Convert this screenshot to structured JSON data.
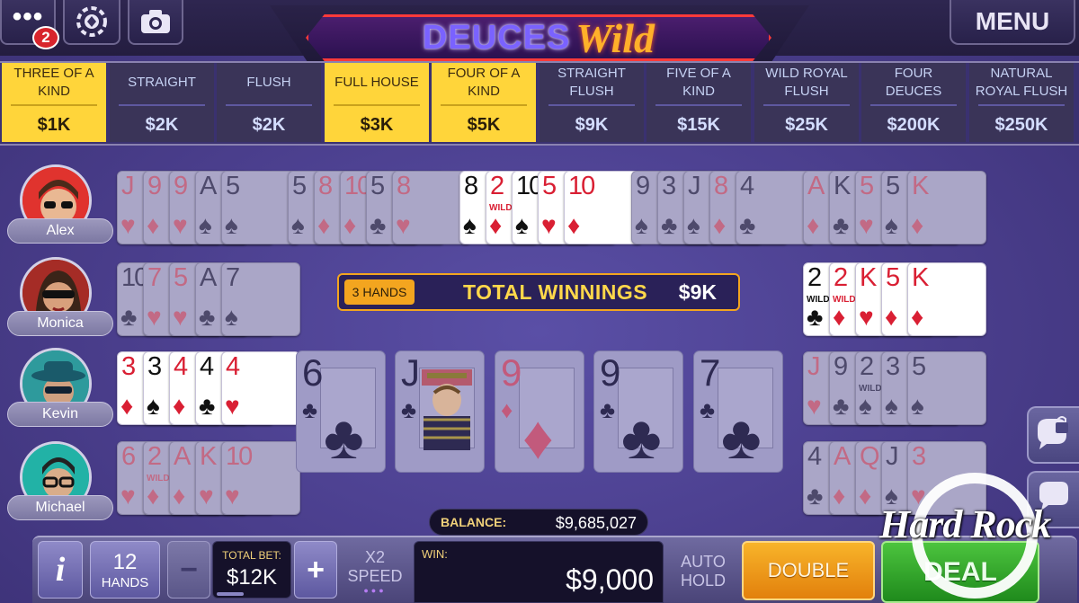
{
  "topbar": {
    "notification_count": "2",
    "menu_label": "MENU",
    "logo_word1": "DEUCES",
    "logo_word2": "Wild"
  },
  "paytable": [
    {
      "name": "THREE OF A KIND",
      "value": "$1K",
      "highlighted": true
    },
    {
      "name": "STRAIGHT",
      "value": "$2K",
      "highlighted": false
    },
    {
      "name": "FLUSH",
      "value": "$2K",
      "highlighted": false
    },
    {
      "name": "FULL HOUSE",
      "value": "$3K",
      "highlighted": true
    },
    {
      "name": "FOUR OF A KIND",
      "value": "$5K",
      "highlighted": true
    },
    {
      "name": "STRAIGHT FLUSH",
      "value": "$9K",
      "highlighted": false
    },
    {
      "name": "FIVE OF A KIND",
      "value": "$15K",
      "highlighted": false
    },
    {
      "name": "WILD ROYAL FLUSH",
      "value": "$25K",
      "highlighted": false
    },
    {
      "name": "FOUR DEUCES",
      "value": "$200K",
      "highlighted": false
    },
    {
      "name": "NATURAL ROYAL FLUSH",
      "value": "$250K",
      "highlighted": false
    }
  ],
  "players": [
    "Alex",
    "Monica",
    "Kevin",
    "Michael"
  ],
  "hands": [
    {
      "dim": true,
      "cards": [
        [
          "J",
          "h"
        ],
        [
          "9",
          "d"
        ],
        [
          "9",
          "h"
        ],
        [
          "A",
          "s"
        ],
        [
          "5",
          "s"
        ]
      ]
    },
    {
      "dim": true,
      "cards": [
        [
          "5",
          "s"
        ],
        [
          "8",
          "d"
        ],
        [
          "10",
          "d"
        ],
        [
          "5",
          "c"
        ],
        [
          "8",
          "h"
        ]
      ]
    },
    {
      "dim": false,
      "cards": [
        [
          "8",
          "s"
        ],
        [
          "2",
          "d",
          "WILD"
        ],
        [
          "10",
          "s"
        ],
        [
          "5",
          "h"
        ],
        [
          "10",
          "d"
        ]
      ]
    },
    {
      "dim": true,
      "cards": [
        [
          "9",
          "s"
        ],
        [
          "3",
          "c"
        ],
        [
          "J",
          "s"
        ],
        [
          "8",
          "d"
        ],
        [
          "4",
          "c"
        ]
      ]
    },
    {
      "dim": true,
      "cards": [
        [
          "A",
          "d"
        ],
        [
          "K",
          "c"
        ],
        [
          "5",
          "h"
        ],
        [
          "5",
          "s"
        ],
        [
          "K",
          "d"
        ]
      ]
    },
    {
      "dim": true,
      "cards": [
        [
          "10",
          "c"
        ],
        [
          "7",
          "h"
        ],
        [
          "5",
          "h"
        ],
        [
          "A",
          "c"
        ],
        [
          "7",
          "s"
        ]
      ]
    },
    {
      "dim": false,
      "cards": [
        [
          "2",
          "c",
          "WILD"
        ],
        [
          "2",
          "d",
          "WILD"
        ],
        [
          "K",
          "h"
        ],
        [
          "5",
          "d"
        ],
        [
          "K",
          "d"
        ]
      ]
    },
    {
      "dim": false,
      "cards": [
        [
          "3",
          "d"
        ],
        [
          "3",
          "s"
        ],
        [
          "4",
          "d"
        ],
        [
          "4",
          "c"
        ],
        [
          "4",
          "h"
        ]
      ]
    },
    {
      "dim": true,
      "cards": [
        [
          "J",
          "h"
        ],
        [
          "9",
          "c"
        ],
        [
          "2",
          "s",
          "WILD"
        ],
        [
          "3",
          "s"
        ],
        [
          "5",
          "s"
        ]
      ]
    },
    {
      "dim": true,
      "cards": [
        [
          "6",
          "h"
        ],
        [
          "2",
          "d",
          "WILD"
        ],
        [
          "A",
          "d"
        ],
        [
          "K",
          "h"
        ],
        [
          "10",
          "h"
        ]
      ]
    },
    {
      "dim": true,
      "cards": [
        [
          "4",
          "c"
        ],
        [
          "A",
          "d"
        ],
        [
          "Q",
          "d"
        ],
        [
          "J",
          "s"
        ],
        [
          "3",
          "h"
        ]
      ]
    }
  ],
  "banner": {
    "hands": "3 HANDS",
    "title": "TOTAL WINNINGS",
    "amount": "$9K"
  },
  "main_hand": [
    [
      "6",
      "c"
    ],
    [
      "J",
      "c"
    ],
    [
      "9",
      "d"
    ],
    [
      "9",
      "c"
    ],
    [
      "7",
      "c"
    ]
  ],
  "controls": {
    "info_label": "i",
    "hands_count": "12",
    "hands_label": "HANDS",
    "minus_label": "−",
    "total_bet_label": "TOTAL BET:",
    "total_bet_value": "$12K",
    "plus_label": "+",
    "speed_line1": "X2",
    "speed_line2": "SPEED",
    "balance_label": "BALANCE:",
    "balance_value": "$9,685,027",
    "win_label": "WIN:",
    "win_value": "$9,000",
    "auto_line1": "AUTO",
    "auto_line2": "HOLD",
    "double_label": "DOUBLE",
    "deal_label": "DEAL"
  },
  "brand": {
    "logo_text": "Hard Rock"
  },
  "colors": {
    "highlight": "#ffd53a",
    "accent_orange": "#f3a51f",
    "deal_green": "#2fa62a",
    "double_orange": "#f39a16"
  }
}
